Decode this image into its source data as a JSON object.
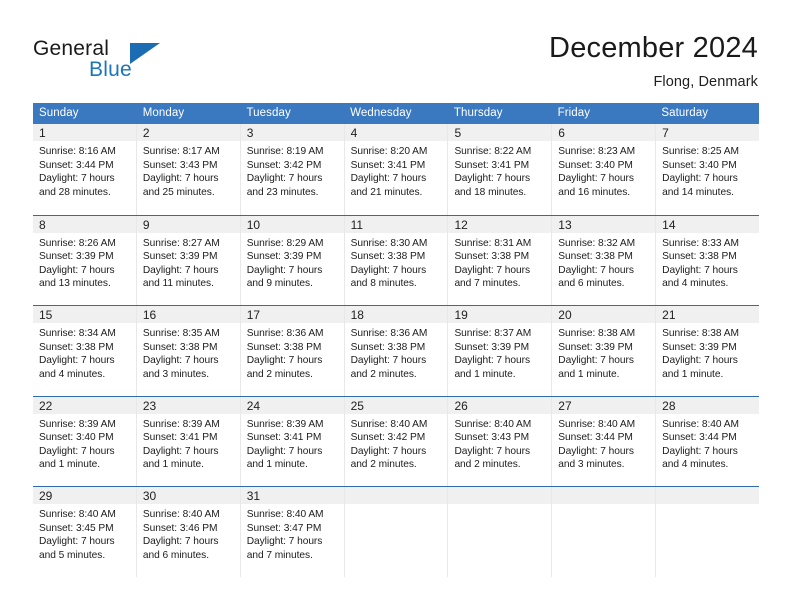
{
  "logo": {
    "primary_text": "General",
    "secondary_text": "Blue",
    "primary_color": "#1b1b1b",
    "secondary_color": "#1b75bb",
    "accent_color": "#1b6cb3"
  },
  "header": {
    "title": "December 2024",
    "location": "Flong, Denmark"
  },
  "theme": {
    "header_bar_color": "#3a79bf",
    "week_divider_color": "#2f6caf",
    "day_band_color": "#f0f0f0",
    "background": "#ffffff",
    "text_color": "#1c1c1c"
  },
  "weekdays": [
    "Sunday",
    "Monday",
    "Tuesday",
    "Wednesday",
    "Thursday",
    "Friday",
    "Saturday"
  ],
  "weeks": [
    [
      {
        "day": "1",
        "sunrise": "Sunrise: 8:16 AM",
        "sunset": "Sunset: 3:44 PM",
        "daylight_line1": "Daylight: 7 hours",
        "daylight_line2": "and 28 minutes."
      },
      {
        "day": "2",
        "sunrise": "Sunrise: 8:17 AM",
        "sunset": "Sunset: 3:43 PM",
        "daylight_line1": "Daylight: 7 hours",
        "daylight_line2": "and 25 minutes."
      },
      {
        "day": "3",
        "sunrise": "Sunrise: 8:19 AM",
        "sunset": "Sunset: 3:42 PM",
        "daylight_line1": "Daylight: 7 hours",
        "daylight_line2": "and 23 minutes."
      },
      {
        "day": "4",
        "sunrise": "Sunrise: 8:20 AM",
        "sunset": "Sunset: 3:41 PM",
        "daylight_line1": "Daylight: 7 hours",
        "daylight_line2": "and 21 minutes."
      },
      {
        "day": "5",
        "sunrise": "Sunrise: 8:22 AM",
        "sunset": "Sunset: 3:41 PM",
        "daylight_line1": "Daylight: 7 hours",
        "daylight_line2": "and 18 minutes."
      },
      {
        "day": "6",
        "sunrise": "Sunrise: 8:23 AM",
        "sunset": "Sunset: 3:40 PM",
        "daylight_line1": "Daylight: 7 hours",
        "daylight_line2": "and 16 minutes."
      },
      {
        "day": "7",
        "sunrise": "Sunrise: 8:25 AM",
        "sunset": "Sunset: 3:40 PM",
        "daylight_line1": "Daylight: 7 hours",
        "daylight_line2": "and 14 minutes."
      }
    ],
    [
      {
        "day": "8",
        "sunrise": "Sunrise: 8:26 AM",
        "sunset": "Sunset: 3:39 PM",
        "daylight_line1": "Daylight: 7 hours",
        "daylight_line2": "and 13 minutes."
      },
      {
        "day": "9",
        "sunrise": "Sunrise: 8:27 AM",
        "sunset": "Sunset: 3:39 PM",
        "daylight_line1": "Daylight: 7 hours",
        "daylight_line2": "and 11 minutes."
      },
      {
        "day": "10",
        "sunrise": "Sunrise: 8:29 AM",
        "sunset": "Sunset: 3:39 PM",
        "daylight_line1": "Daylight: 7 hours",
        "daylight_line2": "and 9 minutes."
      },
      {
        "day": "11",
        "sunrise": "Sunrise: 8:30 AM",
        "sunset": "Sunset: 3:38 PM",
        "daylight_line1": "Daylight: 7 hours",
        "daylight_line2": "and 8 minutes."
      },
      {
        "day": "12",
        "sunrise": "Sunrise: 8:31 AM",
        "sunset": "Sunset: 3:38 PM",
        "daylight_line1": "Daylight: 7 hours",
        "daylight_line2": "and 7 minutes."
      },
      {
        "day": "13",
        "sunrise": "Sunrise: 8:32 AM",
        "sunset": "Sunset: 3:38 PM",
        "daylight_line1": "Daylight: 7 hours",
        "daylight_line2": "and 6 minutes."
      },
      {
        "day": "14",
        "sunrise": "Sunrise: 8:33 AM",
        "sunset": "Sunset: 3:38 PM",
        "daylight_line1": "Daylight: 7 hours",
        "daylight_line2": "and 4 minutes."
      }
    ],
    [
      {
        "day": "15",
        "sunrise": "Sunrise: 8:34 AM",
        "sunset": "Sunset: 3:38 PM",
        "daylight_line1": "Daylight: 7 hours",
        "daylight_line2": "and 4 minutes."
      },
      {
        "day": "16",
        "sunrise": "Sunrise: 8:35 AM",
        "sunset": "Sunset: 3:38 PM",
        "daylight_line1": "Daylight: 7 hours",
        "daylight_line2": "and 3 minutes."
      },
      {
        "day": "17",
        "sunrise": "Sunrise: 8:36 AM",
        "sunset": "Sunset: 3:38 PM",
        "daylight_line1": "Daylight: 7 hours",
        "daylight_line2": "and 2 minutes."
      },
      {
        "day": "18",
        "sunrise": "Sunrise: 8:36 AM",
        "sunset": "Sunset: 3:38 PM",
        "daylight_line1": "Daylight: 7 hours",
        "daylight_line2": "and 2 minutes."
      },
      {
        "day": "19",
        "sunrise": "Sunrise: 8:37 AM",
        "sunset": "Sunset: 3:39 PM",
        "daylight_line1": "Daylight: 7 hours",
        "daylight_line2": "and 1 minute."
      },
      {
        "day": "20",
        "sunrise": "Sunrise: 8:38 AM",
        "sunset": "Sunset: 3:39 PM",
        "daylight_line1": "Daylight: 7 hours",
        "daylight_line2": "and 1 minute."
      },
      {
        "day": "21",
        "sunrise": "Sunrise: 8:38 AM",
        "sunset": "Sunset: 3:39 PM",
        "daylight_line1": "Daylight: 7 hours",
        "daylight_line2": "and 1 minute."
      }
    ],
    [
      {
        "day": "22",
        "sunrise": "Sunrise: 8:39 AM",
        "sunset": "Sunset: 3:40 PM",
        "daylight_line1": "Daylight: 7 hours",
        "daylight_line2": "and 1 minute."
      },
      {
        "day": "23",
        "sunrise": "Sunrise: 8:39 AM",
        "sunset": "Sunset: 3:41 PM",
        "daylight_line1": "Daylight: 7 hours",
        "daylight_line2": "and 1 minute."
      },
      {
        "day": "24",
        "sunrise": "Sunrise: 8:39 AM",
        "sunset": "Sunset: 3:41 PM",
        "daylight_line1": "Daylight: 7 hours",
        "daylight_line2": "and 1 minute."
      },
      {
        "day": "25",
        "sunrise": "Sunrise: 8:40 AM",
        "sunset": "Sunset: 3:42 PM",
        "daylight_line1": "Daylight: 7 hours",
        "daylight_line2": "and 2 minutes."
      },
      {
        "day": "26",
        "sunrise": "Sunrise: 8:40 AM",
        "sunset": "Sunset: 3:43 PM",
        "daylight_line1": "Daylight: 7 hours",
        "daylight_line2": "and 2 minutes."
      },
      {
        "day": "27",
        "sunrise": "Sunrise: 8:40 AM",
        "sunset": "Sunset: 3:44 PM",
        "daylight_line1": "Daylight: 7 hours",
        "daylight_line2": "and 3 minutes."
      },
      {
        "day": "28",
        "sunrise": "Sunrise: 8:40 AM",
        "sunset": "Sunset: 3:44 PM",
        "daylight_line1": "Daylight: 7 hours",
        "daylight_line2": "and 4 minutes."
      }
    ],
    [
      {
        "day": "29",
        "sunrise": "Sunrise: 8:40 AM",
        "sunset": "Sunset: 3:45 PM",
        "daylight_line1": "Daylight: 7 hours",
        "daylight_line2": "and 5 minutes."
      },
      {
        "day": "30",
        "sunrise": "Sunrise: 8:40 AM",
        "sunset": "Sunset: 3:46 PM",
        "daylight_line1": "Daylight: 7 hours",
        "daylight_line2": "and 6 minutes."
      },
      {
        "day": "31",
        "sunrise": "Sunrise: 8:40 AM",
        "sunset": "Sunset: 3:47 PM",
        "daylight_line1": "Daylight: 7 hours",
        "daylight_line2": "and 7 minutes."
      },
      {
        "day": "",
        "sunrise": "",
        "sunset": "",
        "daylight_line1": "",
        "daylight_line2": ""
      },
      {
        "day": "",
        "sunrise": "",
        "sunset": "",
        "daylight_line1": "",
        "daylight_line2": ""
      },
      {
        "day": "",
        "sunrise": "",
        "sunset": "",
        "daylight_line1": "",
        "daylight_line2": ""
      },
      {
        "day": "",
        "sunrise": "",
        "sunset": "",
        "daylight_line1": "",
        "daylight_line2": ""
      }
    ]
  ]
}
